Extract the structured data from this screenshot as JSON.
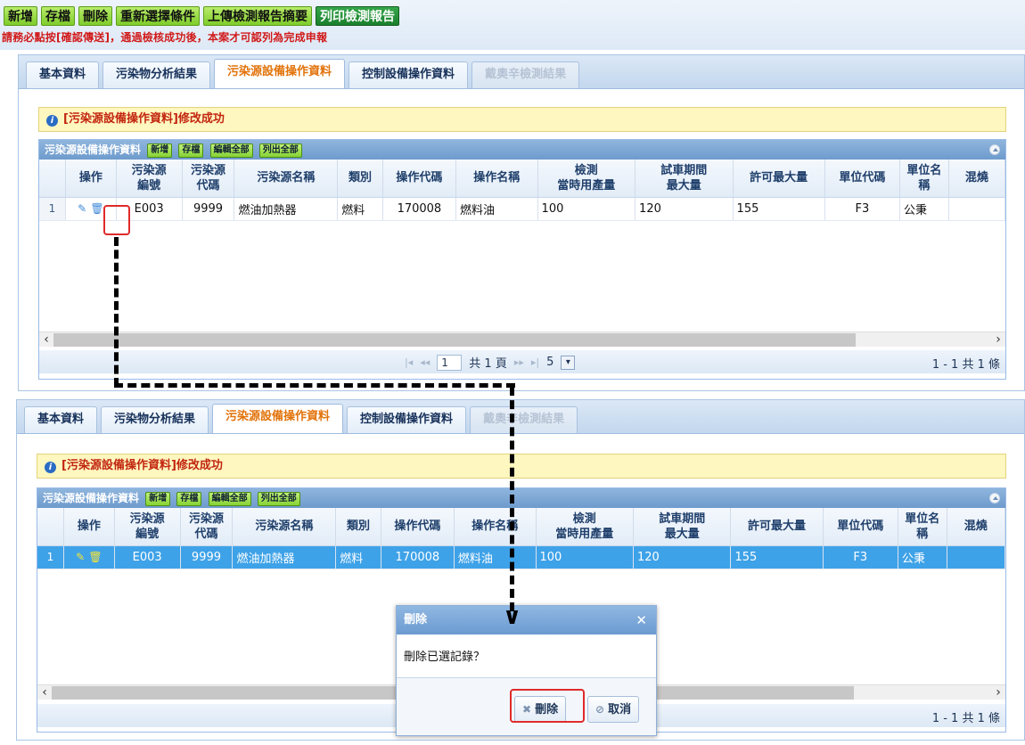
{
  "toolbar": {
    "buttons": [
      "新增",
      "存檔",
      "刪除",
      "重新選擇條件",
      "上傳檢測報告摘要",
      "列印檢測報告"
    ],
    "warning": "請務必點按[確認傳送]，通過檢核成功後，本案才可認列為完成申報"
  },
  "tabs": [
    "基本資料",
    "污染物分析結果",
    "污染源設備操作資料",
    "控制設備操作資料",
    "戴奧辛檢測結果"
  ],
  "notice": "[污染源設備操作資料]修改成功",
  "grid": {
    "title": "污染源設備操作資料",
    "title_buttons": [
      "新增",
      "存檔",
      "編輯全部",
      "列出全部"
    ],
    "columns": [
      [
        "操作"
      ],
      [
        "污染源",
        "編號"
      ],
      [
        "污染源",
        "代碼"
      ],
      [
        "污染源名稱"
      ],
      [
        "類別"
      ],
      [
        "操作代碼"
      ],
      [
        "操作名稱"
      ],
      [
        "檢測",
        "當時用產量"
      ],
      [
        "試車期間",
        "最大量"
      ],
      [
        "許可最大量"
      ],
      [
        "單位代碼"
      ],
      [
        "單位名",
        "稱"
      ],
      [
        "混燒"
      ]
    ],
    "row": {
      "num": "1",
      "source_id": "E003",
      "source_code": "9999",
      "source_name": "燃油加熱器",
      "category": "燃料",
      "op_code": "170008",
      "op_name": "燃料油",
      "test_yield": "100",
      "trial_max": "120",
      "permit_max": "155",
      "unit_code": "F3",
      "unit_name": "公秉",
      "cofire": ""
    }
  },
  "pager": {
    "page": "1",
    "total_pages": "共 1 頁",
    "page_size": "5",
    "summary": "1 - 1 共 1 條"
  },
  "dialog": {
    "title": "刪除",
    "message": "刪除已選記錄？",
    "delete_label": "刪除",
    "cancel_label": "取消"
  },
  "colors": {
    "toolbar_btn": "#8ad63a",
    "warning": "#d11a1a",
    "active_tab": "#e2730b",
    "selected_row": "#3ea2e8",
    "annotation": "#e02a2a"
  }
}
